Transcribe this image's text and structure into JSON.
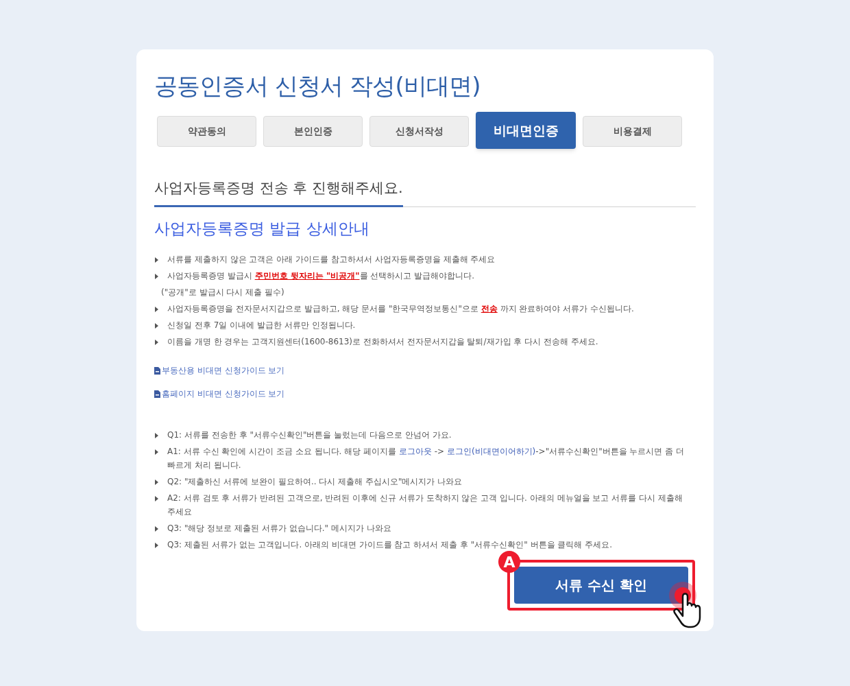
{
  "title": "공동인증서 신청서 작성(비대면)",
  "steps": [
    {
      "label": "약관동의",
      "selected": false
    },
    {
      "label": "본인인증",
      "selected": false
    },
    {
      "label": "신청서작성",
      "selected": false
    },
    {
      "label": "비대면인증",
      "selected": true
    },
    {
      "label": "비용결제",
      "selected": false
    }
  ],
  "section_heading": "사업자등록증명 전송 후 진행해주세요.",
  "guide_title": "사업자등록증명 발급 상세안내",
  "notices": [
    {
      "kind": "bullet",
      "segments": [
        {
          "kind": "text",
          "text": "서류를 제출하지 않은 고객은 아래 가이드를 참고하셔서 사업자등록증명을 제출해 주세요"
        }
      ]
    },
    {
      "kind": "bullet",
      "segments": [
        {
          "kind": "text",
          "text": "사업자등록증명 발급시 "
        },
        {
          "kind": "emphasis",
          "text": "주민번호 뒷자리는 \"비공개\""
        },
        {
          "kind": "text",
          "text": "를 선택하시고 발급해야합니다."
        }
      ]
    },
    {
      "kind": "note",
      "segments": [
        {
          "kind": "text",
          "text": "(\"공개\"로 발급시 다시 제출 필수)"
        }
      ]
    },
    {
      "kind": "bullet",
      "segments": [
        {
          "kind": "text",
          "text": "사업자등록증명을 전자문서지갑으로 발급하고, 해당 문서를 \"한국무역정보통신\"으로 "
        },
        {
          "kind": "emphasis",
          "text": "전송"
        },
        {
          "kind": "text",
          "text": " 까지 완료하여야 서류가 수신됩니다."
        }
      ]
    },
    {
      "kind": "bullet",
      "segments": [
        {
          "kind": "text",
          "text": "신청일 전후 7일 이내에 발급한 서류만 인정됩니다."
        }
      ]
    },
    {
      "kind": "bullet",
      "segments": [
        {
          "kind": "text",
          "text": "이름을 개명 한 경우는 고객지원센터(1600-8613)로 전화하셔서 전자문서지갑을 탈퇴/재가입 후 다시 전송해 주세요."
        }
      ]
    }
  ],
  "guide_links": [
    "부동산용 비대면 신청가이드 보기",
    "홈페이지 비대면 신청가이드 보기"
  ],
  "faq": [
    {
      "kind": "bullet",
      "segments": [
        {
          "kind": "text",
          "text": "Q1: 서류를 전송한 후 \"서류수신확인\"버튼을 눌렀는데 다음으로 안넘어 가요."
        }
      ]
    },
    {
      "kind": "bullet",
      "segments": [
        {
          "kind": "text",
          "text": "A1: 서류 수신 확인에 시간이 조금 소요 됩니다. 해당 페이지를 "
        },
        {
          "kind": "link",
          "text": "로그아웃"
        },
        {
          "kind": "text",
          "text": " -> "
        },
        {
          "kind": "link",
          "text": "로그인(비대면이어하기)"
        },
        {
          "kind": "text",
          "text": "->\"서류수신확인\"버튼을 누르시면 좀 더 빠르게 처리 됩니다."
        }
      ]
    },
    {
      "kind": "bullet",
      "segments": [
        {
          "kind": "text",
          "text": "Q2: \"제출하신 서류에 보완이 필요하여.. 다시 제출해 주십시오\"메시지가 나와요"
        }
      ]
    },
    {
      "kind": "bullet",
      "segments": [
        {
          "kind": "text",
          "text": "A2: 서류 검토 후 서류가 반려된 고객으로, 반려된 이후에 신규 서류가 도착하지 않은 고객 입니다. 아래의 메뉴얼을 보고 서류를 다시 제출해 주세요"
        }
      ]
    },
    {
      "kind": "bullet",
      "segments": [
        {
          "kind": "text",
          "text": "Q3: \"해당 정보로 제출된 서류가 없습니다.\" 메시지가 나와요"
        }
      ]
    },
    {
      "kind": "bullet",
      "segments": [
        {
          "kind": "text",
          "text": "Q3: 제출된 서류가 없는 고객입니다. 아래의 비대면 가이드를 참고 하셔서 제출 후 \"서류수신확인\" 버튼을 클릭해 주세요."
        }
      ]
    }
  ],
  "confirm_button": {
    "label": "서류 수신 확인",
    "highlighted": true,
    "badge": "A"
  }
}
